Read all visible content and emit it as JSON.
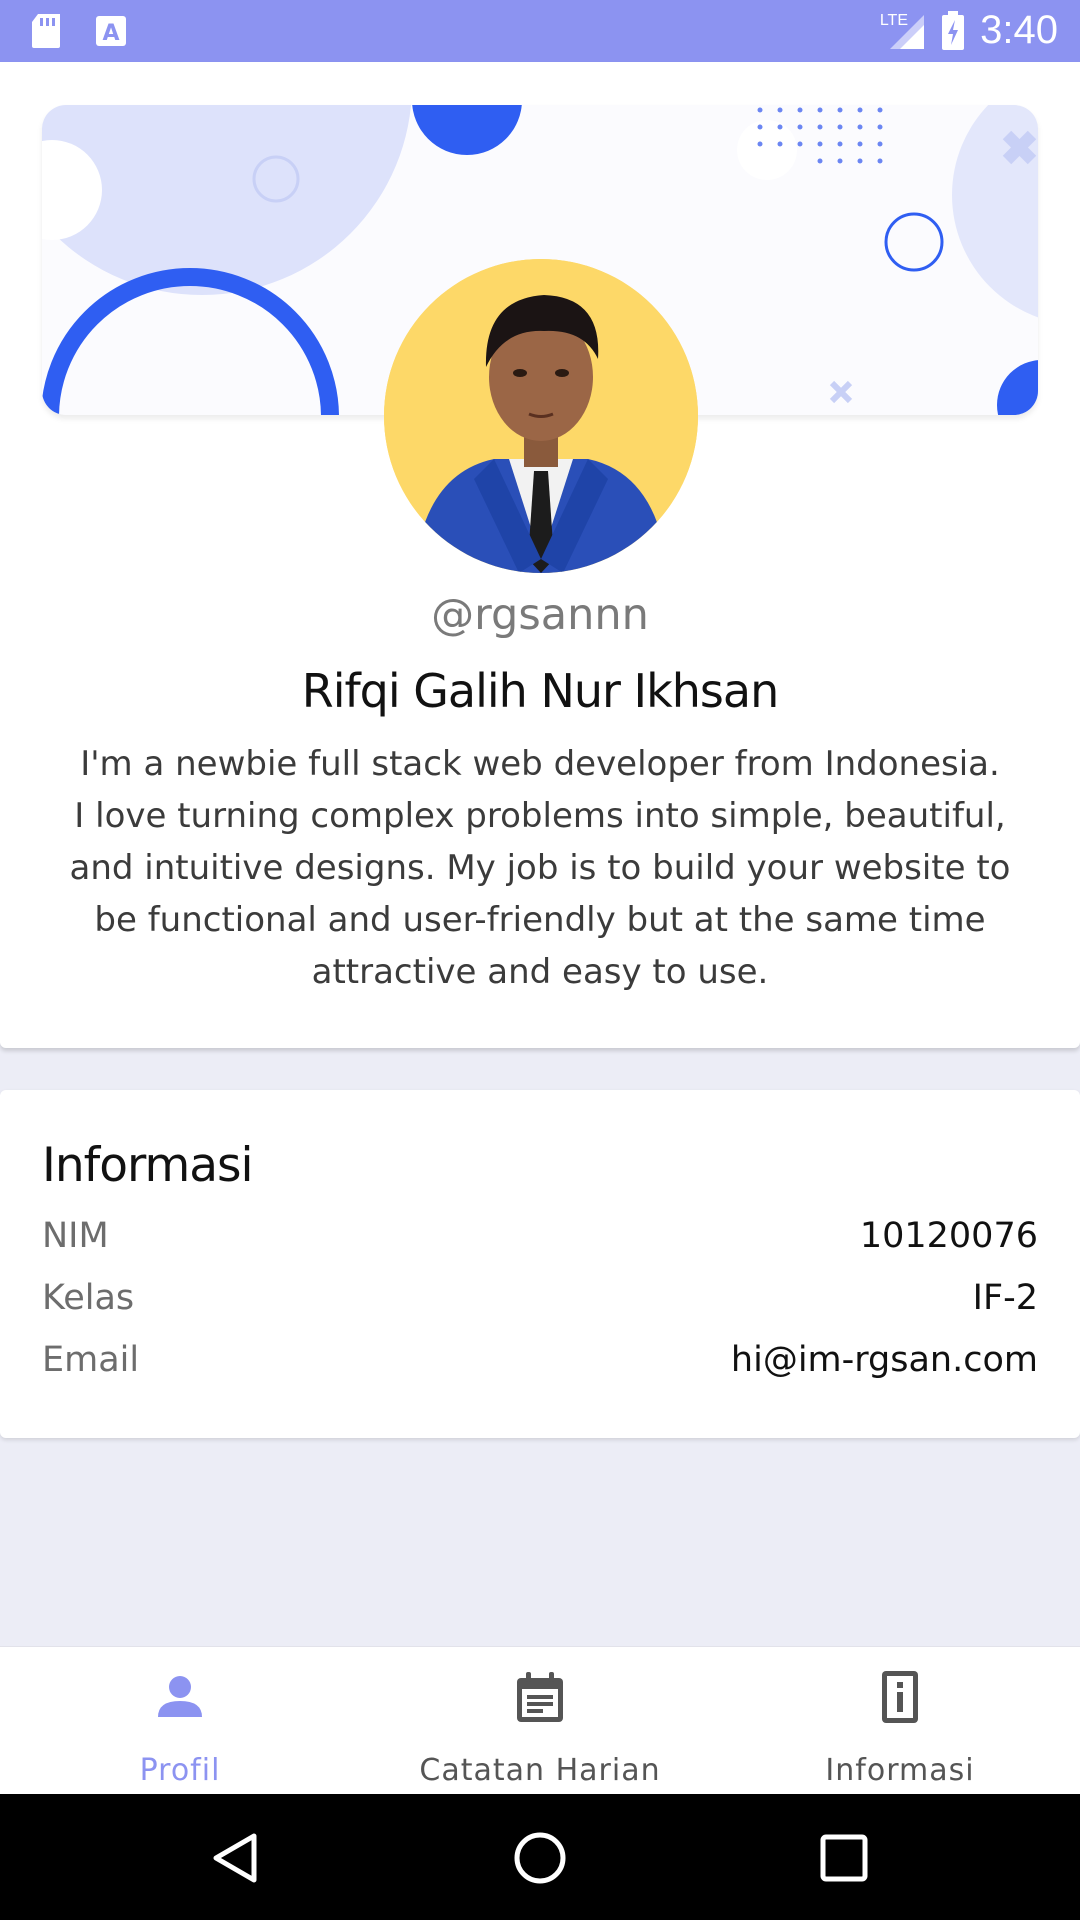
{
  "status_bar": {
    "time": "3:40",
    "network": "LTE",
    "bg_color": "#8c93f1",
    "icons": [
      "sd-card-icon",
      "font-a-icon",
      "signal-icon",
      "battery-charging-icon"
    ]
  },
  "profile": {
    "handle": "@rgsannn",
    "name": "Rifqi Galih Nur Ikhsan",
    "bio_lines": [
      "I'm a newbie full stack web developer from Indonesia.",
      "I love turning complex problems into simple, beautiful,",
      "and intuitive designs. My job is to build your website to",
      "be functional and user-friendly but at the same time",
      "attractive and easy to use."
    ]
  },
  "info": {
    "title": "Informasi",
    "rows": [
      {
        "label": "NIM",
        "value": "10120076"
      },
      {
        "label": "Kelas",
        "value": "IF-2"
      },
      {
        "label": "Email",
        "value": "hi@im-rgsan.com"
      }
    ]
  },
  "bottom_nav": {
    "items": [
      {
        "label": "Profil",
        "icon": "person-icon",
        "active": true
      },
      {
        "label": "Catatan Harian",
        "icon": "calendar-icon",
        "active": false
      },
      {
        "label": "Informasi",
        "icon": "info-icon",
        "active": false
      }
    ],
    "active_color": "#8c93f1",
    "inactive_color": "#555555"
  },
  "system_nav": {
    "buttons": [
      "back-icon",
      "home-icon",
      "recents-icon"
    ]
  }
}
